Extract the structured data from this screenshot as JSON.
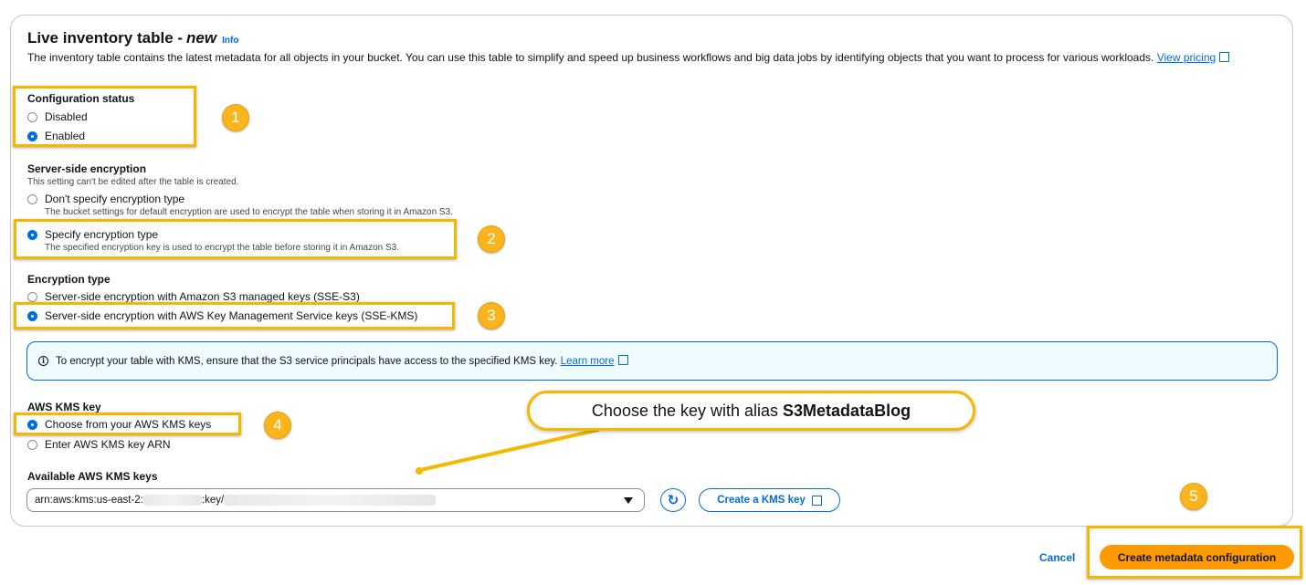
{
  "header": {
    "title": "Live inventory table -",
    "title_new": "new",
    "info_label": "Info",
    "description": "The inventory table contains the latest metadata for all objects in your bucket. You can use this table to simplify and speed up business workflows and big data jobs by identifying objects that you want to process for various workloads.",
    "pricing_link": "View pricing"
  },
  "configuration_status": {
    "label": "Configuration status",
    "options": [
      {
        "label": "Disabled",
        "checked": false
      },
      {
        "label": "Enabled",
        "checked": true
      }
    ]
  },
  "server_side_encryption": {
    "label": "Server-side encryption",
    "hint": "This setting can't be edited after the table is created.",
    "options": [
      {
        "label": "Don't specify encryption type",
        "description": "The bucket settings for default encryption are used to encrypt the table when storing it in Amazon S3.",
        "checked": false
      },
      {
        "label": "Specify encryption type",
        "description": "The specified encryption key is used to encrypt the table before storing it in Amazon S3.",
        "checked": true
      }
    ]
  },
  "encryption_type": {
    "label": "Encryption type",
    "options": [
      {
        "label": "Server-side encryption with Amazon S3 managed keys (SSE-S3)",
        "checked": false
      },
      {
        "label": "Server-side encryption with AWS Key Management Service keys (SSE-KMS)",
        "checked": true
      }
    ]
  },
  "alert": {
    "text": "To encrypt your table with KMS, ensure that the S3 service principals have access to the specified KMS key.",
    "link": "Learn more"
  },
  "kms_key": {
    "label": "AWS KMS key",
    "options": [
      {
        "label": "Choose from your AWS KMS keys",
        "checked": true
      },
      {
        "label": "Enter AWS KMS key ARN",
        "checked": false
      }
    ],
    "available_label": "Available AWS KMS keys",
    "selected_prefix": "arn:aws:kms:us-east-2:",
    "selected_middle": ":key/",
    "create_button": "Create a KMS key"
  },
  "callout": {
    "text": "Choose the key with alias",
    "alias": "S3MetadataBlog"
  },
  "badges": [
    "1",
    "2",
    "3",
    "4",
    "5"
  ],
  "footer": {
    "cancel": "Cancel",
    "submit": "Create metadata configuration"
  },
  "colors": {
    "accent": "#006ce0",
    "highlight": "#f5b800",
    "primary_button": "#ff9900"
  }
}
